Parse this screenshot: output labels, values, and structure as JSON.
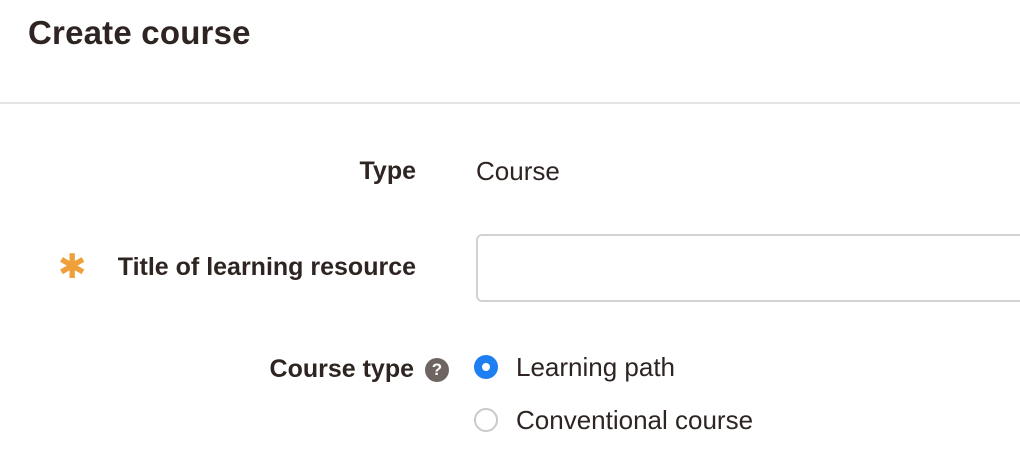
{
  "header": {
    "title": "Create course"
  },
  "form": {
    "type": {
      "label": "Type",
      "value": "Course"
    },
    "title_of_resource": {
      "label": "Title of learning resource",
      "required_marker": "✱",
      "input_value": "",
      "placeholder": ""
    },
    "course_type": {
      "label": "Course type",
      "help_glyph": "?",
      "options": [
        {
          "label": "Learning path",
          "selected": true
        },
        {
          "label": "Conventional course",
          "selected": false
        }
      ]
    }
  },
  "colors": {
    "required": "#f0a03a",
    "radio_selected": "#1e7ff2",
    "help_icon": "#6e6560",
    "heading_text": "#2e2522"
  },
  "icons": {
    "required": "required-asterisk-icon",
    "help": "help-question-icon"
  }
}
